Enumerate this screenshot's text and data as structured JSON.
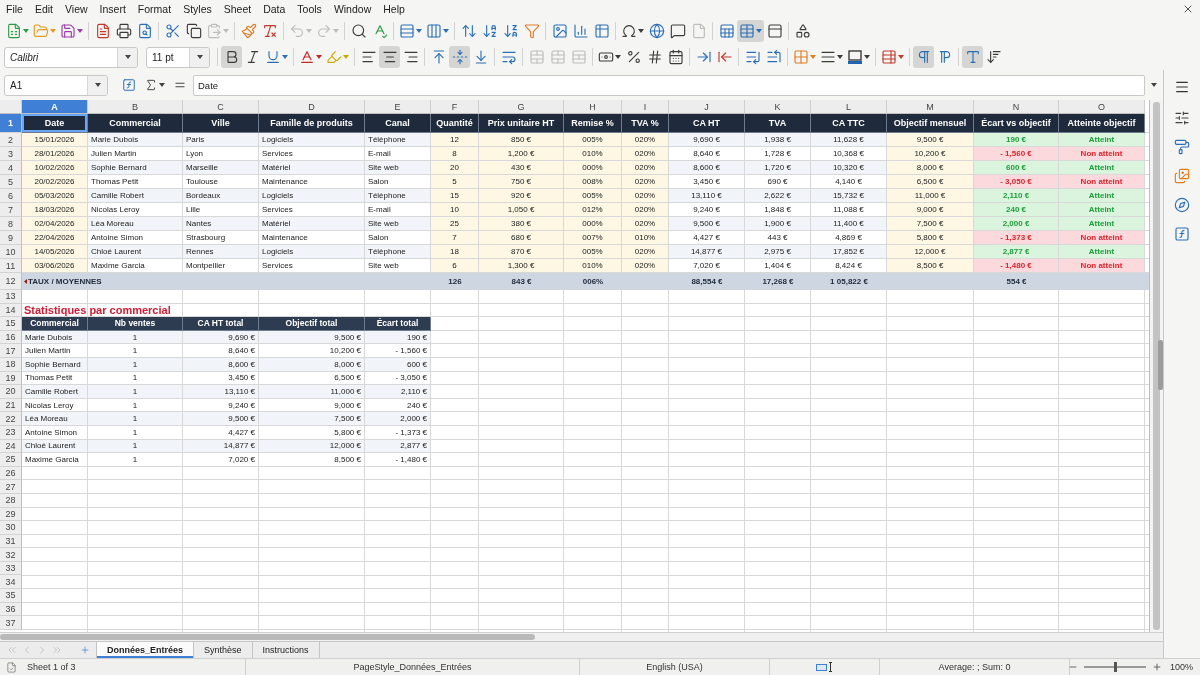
{
  "menu_bar": {
    "items": [
      "File",
      "Edit",
      "View",
      "Insert",
      "Format",
      "Styles",
      "Sheet",
      "Data",
      "Tools",
      "Window",
      "Help"
    ]
  },
  "standard_toolbar": {
    "paste_enabled": false,
    "undo_enabled": false,
    "redo_enabled": false,
    "header_footer_enabled": false,
    "freeze_active": true
  },
  "formatting_toolbar": {
    "font_name": "Calibri",
    "font_size": "11 pt",
    "bold": true,
    "italic": false,
    "underline": false,
    "align_left": false,
    "align_center": true,
    "align_right": false,
    "align_top": false,
    "align_middle": true,
    "align_bottom": false,
    "merge_enabled": false,
    "left_to_right": true,
    "right_to_left": false,
    "text_horizontal": true,
    "text_vertical": false
  },
  "formula_bar": {
    "name_box": "A1",
    "content": "Date"
  },
  "sheet": {
    "column_headers": [
      {
        "label": "A",
        "selected": true
      },
      {
        "label": "B",
        "selected": false
      },
      {
        "label": "C",
        "selected": false
      },
      {
        "label": "D",
        "selected": false
      },
      {
        "label": "E",
        "selected": false
      },
      {
        "label": "F",
        "selected": false
      },
      {
        "label": "G",
        "selected": false
      },
      {
        "label": "H",
        "selected": false
      },
      {
        "label": "I",
        "selected": false
      },
      {
        "label": "J",
        "selected": false
      },
      {
        "label": "K",
        "selected": false
      },
      {
        "label": "L",
        "selected": false
      },
      {
        "label": "M",
        "selected": false
      },
      {
        "label": "N",
        "selected": false
      },
      {
        "label": "O",
        "selected": false
      }
    ],
    "row_headers": [
      {
        "label": "1",
        "selected": true
      },
      {
        "label": "2",
        "selected": false
      },
      {
        "label": "3",
        "selected": false
      },
      {
        "label": "4",
        "selected": false
      },
      {
        "label": "5",
        "selected": false
      },
      {
        "label": "6",
        "selected": false
      },
      {
        "label": "7",
        "selected": false
      },
      {
        "label": "8",
        "selected": false
      },
      {
        "label": "9",
        "selected": false
      },
      {
        "label": "10",
        "selected": false
      },
      {
        "label": "11",
        "selected": false
      },
      {
        "label": "12",
        "selected": false
      },
      {
        "label": "13",
        "selected": false
      },
      {
        "label": "14",
        "selected": false
      },
      {
        "label": "15",
        "selected": false
      },
      {
        "label": "16",
        "selected": false
      },
      {
        "label": "17",
        "selected": false
      },
      {
        "label": "18",
        "selected": false
      },
      {
        "label": "19",
        "selected": false
      },
      {
        "label": "20",
        "selected": false
      },
      {
        "label": "21",
        "selected": false
      },
      {
        "label": "22",
        "selected": false
      },
      {
        "label": "23",
        "selected": false
      },
      {
        "label": "24",
        "selected": false
      },
      {
        "label": "25",
        "selected": false
      },
      {
        "label": "26",
        "selected": false
      },
      {
        "label": "27",
        "selected": false
      },
      {
        "label": "28",
        "selected": false
      },
      {
        "label": "29",
        "selected": false
      },
      {
        "label": "30",
        "selected": false
      },
      {
        "label": "31",
        "selected": false
      },
      {
        "label": "32",
        "selected": false
      },
      {
        "label": "33",
        "selected": false
      },
      {
        "label": "34",
        "selected": false
      },
      {
        "label": "35",
        "selected": false
      },
      {
        "label": "36",
        "selected": false
      },
      {
        "label": "37",
        "selected": false
      }
    ],
    "sales_table": {
      "columns": [
        "Date",
        "Commercial",
        "Ville",
        "Famille de produits",
        "Canal",
        "Quantité",
        "Prix unitaire HT",
        "Remise %",
        "TVA %",
        "CA HT",
        "TVA",
        "CA TTC",
        "Objectif mensuel",
        "Écart vs objectif",
        "Atteinte objectif"
      ],
      "rows": [
        {
          "cells": [
            "15/01/2026",
            "Marie Dubois",
            "Paris",
            "Logiciels",
            "Téléphone",
            "12",
            "850 €",
            "005%",
            "020%",
            "9,690 €",
            "1,938 €",
            "11,628 €",
            "9,500 €",
            "190 €",
            "Atteint"
          ],
          "met": true
        },
        {
          "cells": [
            "28/01/2026",
            "Julien Martin",
            "Lyon",
            "Services",
            "E-mail",
            "8",
            "1,200 €",
            "010%",
            "020%",
            "8,640 €",
            "1,728 €",
            "10,368 €",
            "10,200 €",
            "- 1,560 €",
            "Non atteint"
          ],
          "met": false
        },
        {
          "cells": [
            "10/02/2026",
            "Sophie Bernard",
            "Marseille",
            "Matériel",
            "Site web",
            "20",
            "430 €",
            "000%",
            "020%",
            "8,600 €",
            "1,720 €",
            "10,320 €",
            "8,000 €",
            "600 €",
            "Atteint"
          ],
          "met": true
        },
        {
          "cells": [
            "20/02/2026",
            "Thomas Petit",
            "Toulouse",
            "Maintenance",
            "Salon",
            "5",
            "750 €",
            "008%",
            "020%",
            "3,450 €",
            "690 €",
            "4,140 €",
            "6,500 €",
            "- 3,050 €",
            "Non atteint"
          ],
          "met": false
        },
        {
          "cells": [
            "05/03/2026",
            "Camille Robert",
            "Bordeaux",
            "Logiciels",
            "Téléphone",
            "15",
            "920 €",
            "005%",
            "020%",
            "13,110 €",
            "2,622 €",
            "15,732 €",
            "11,000 €",
            "2,110 €",
            "Atteint"
          ],
          "met": true
        },
        {
          "cells": [
            "18/03/2026",
            "Nicolas Leroy",
            "Lille",
            "Services",
            "E-mail",
            "10",
            "1,050 €",
            "012%",
            "020%",
            "9,240 €",
            "1,848 €",
            "11,088 €",
            "9,000 €",
            "240 €",
            "Atteint"
          ],
          "met": true
        },
        {
          "cells": [
            "02/04/2026",
            "Léa Moreau",
            "Nantes",
            "Matériel",
            "Site web",
            "25",
            "380 €",
            "000%",
            "020%",
            "9,500 €",
            "1,900 €",
            "11,400 €",
            "7,500 €",
            "2,000 €",
            "Atteint"
          ],
          "met": true
        },
        {
          "cells": [
            "22/04/2026",
            "Antoine Simon",
            "Strasbourg",
            "Maintenance",
            "Salon",
            "7",
            "680 €",
            "007%",
            "010%",
            "4,427 €",
            "443 €",
            "4,869 €",
            "5,800 €",
            "- 1,373 €",
            "Non atteint"
          ],
          "met": false
        },
        {
          "cells": [
            "14/05/2026",
            "Chloé Laurent",
            "Rennes",
            "Logiciels",
            "Téléphone",
            "18",
            "870 €",
            "005%",
            "020%",
            "14,877 €",
            "2,975 €",
            "17,852 €",
            "12,000 €",
            "2,877 €",
            "Atteint"
          ],
          "met": true
        },
        {
          "cells": [
            "03/06/2026",
            "Maxime Garcia",
            "Montpellier",
            "Services",
            "Site web",
            "6",
            "1,300 €",
            "010%",
            "020%",
            "7,020 €",
            "1,404 €",
            "8,424 €",
            "8,500 €",
            "- 1,480 €",
            "Non atteint"
          ],
          "met": false
        }
      ],
      "totals": {
        "label": "TAUX / MOYENNES",
        "overflow_marker": true,
        "values": {
          "quantity": "126",
          "unit_price": "843 €",
          "discount": "006%",
          "revenue_ht": "88,554 €",
          "vat": "17,268 €",
          "revenue_ttc": "1 05,822 €",
          "gap": "554 €"
        }
      }
    },
    "summary_table": {
      "title": "Statistiques par commercial",
      "columns": [
        "Commercial",
        "Nb ventes",
        "CA HT total",
        "Objectif total",
        "Écart total"
      ],
      "rows": [
        [
          "Marie Dubois",
          "1",
          "9,690 €",
          "9,500 €",
          "190 €"
        ],
        [
          "Julien Martin",
          "1",
          "8,640 €",
          "10,200 €",
          "- 1,560 €"
        ],
        [
          "Sophie Bernard",
          "1",
          "8,600 €",
          "8,000 €",
          "600 €"
        ],
        [
          "Thomas Petit",
          "1",
          "3,450 €",
          "6,500 €",
          "- 3,050 €"
        ],
        [
          "Camille Robert",
          "1",
          "13,110 €",
          "11,000 €",
          "2,110 €"
        ],
        [
          "Nicolas Leroy",
          "1",
          "9,240 €",
          "9,000 €",
          "240 €"
        ],
        [
          "Léa Moreau",
          "1",
          "9,500 €",
          "7,500 €",
          "2,000 €"
        ],
        [
          "Antoine Simon",
          "1",
          "4,427 €",
          "5,800 €",
          "- 1,373 €"
        ],
        [
          "Chloé Laurent",
          "1",
          "14,877 €",
          "12,000 €",
          "2,877 €"
        ],
        [
          "Maxime Garcia",
          "1",
          "7,020 €",
          "8,500 €",
          "- 1,480 €"
        ]
      ]
    }
  },
  "sheet_tabs": [
    {
      "label": "Données_Entrées",
      "selected": true
    },
    {
      "label": "Synthèse",
      "selected": false
    },
    {
      "label": "Instructions",
      "selected": false
    }
  ],
  "status_bar": {
    "sheet_position": "Sheet 1 of 3",
    "page_style": "PageStyle_Données_Entrées",
    "language": "English (USA)",
    "selection_summary": "Average: ; Sum: 0",
    "zoom": {
      "level": 0.5,
      "reading": "100%"
    }
  }
}
